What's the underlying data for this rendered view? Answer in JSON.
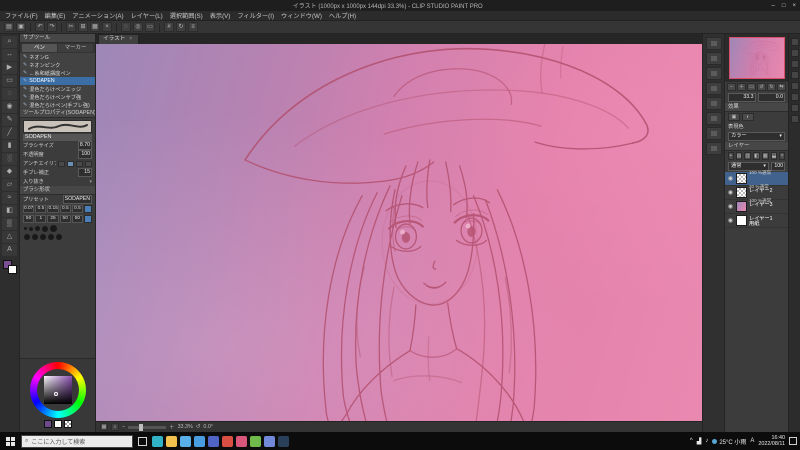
{
  "window": {
    "title": "イラスト (1000px x 1000px 144dpi 33.3%) - CLIP STUDIO PAINT PRO",
    "controls": {
      "minimize": "–",
      "maximize": "□",
      "close": "×"
    }
  },
  "menubar": {
    "items": [
      "ファイル(F)",
      "編集(E)",
      "アニメーション(A)",
      "レイヤー(L)",
      "選択範囲(S)",
      "表示(V)",
      "フィルター(I)",
      "ウィンドウ(W)",
      "ヘルプ(H)"
    ]
  },
  "toolbar": {
    "icons": [
      {
        "name": "new",
        "glyph": "▤"
      },
      {
        "name": "save",
        "glyph": "▣"
      },
      {
        "name": "undo",
        "glyph": "↶"
      },
      {
        "name": "redo",
        "glyph": "↷"
      },
      {
        "name": "cut",
        "glyph": "✂"
      },
      {
        "name": "copy",
        "glyph": "⊞"
      },
      {
        "name": "paste",
        "glyph": "▦"
      },
      {
        "name": "delete",
        "glyph": "×"
      },
      {
        "name": "deselect",
        "glyph": "◌"
      },
      {
        "name": "invert-selection",
        "glyph": "◎"
      },
      {
        "name": "selection-launcher",
        "glyph": "▭"
      },
      {
        "name": "grid",
        "glyph": "#"
      },
      {
        "name": "rotate-view",
        "glyph": "↻"
      },
      {
        "name": "workspace-settings",
        "glyph": "≡"
      }
    ]
  },
  "toolstrip": {
    "tools": [
      {
        "name": "zoom",
        "glyph": "⌕"
      },
      {
        "name": "move",
        "glyph": "↔"
      },
      {
        "name": "operation",
        "glyph": "▶"
      },
      {
        "name": "selection",
        "glyph": "▭"
      },
      {
        "name": "lasso",
        "glyph": "◌"
      },
      {
        "name": "eyedropper",
        "glyph": "◉"
      },
      {
        "name": "pen",
        "glyph": "✎"
      },
      {
        "name": "pencil",
        "glyph": "╱"
      },
      {
        "name": "brush",
        "glyph": "▮"
      },
      {
        "name": "airbrush",
        "glyph": "░"
      },
      {
        "name": "decoration",
        "glyph": "◆"
      },
      {
        "name": "eraser",
        "glyph": "▱"
      },
      {
        "name": "blend",
        "glyph": "≈"
      },
      {
        "name": "fill",
        "glyph": "◧"
      },
      {
        "name": "gradient",
        "glyph": "▒"
      },
      {
        "name": "figure",
        "glyph": "△"
      },
      {
        "name": "text",
        "glyph": "A"
      }
    ],
    "main_color": "#7b4f93",
    "sub_color": "#ffffff"
  },
  "subtool": {
    "panel_title": "サブツール",
    "tabs": [
      "ペン",
      "マーカー"
    ],
    "items": [
      "ネオンG",
      "ネオンピンク",
      "←糸和紙講座ペン",
      "SODAPEN",
      "混色だらけペンエッジ",
      "混色だらけペンサブ強",
      "混色だらけペン(手ブレ強)"
    ]
  },
  "tool_property": {
    "panel_title": "ツールプロパティ(SODAPEN)",
    "brush_name": "SODAPEN",
    "sliders": [
      {
        "label": "ブラシサイズ",
        "value": "8.70"
      },
      {
        "label": "不透明度",
        "value": "100"
      },
      {
        "label": "アンチエイリアス",
        "value": ""
      },
      {
        "label": "手ブレ補正",
        "value": "15"
      }
    ],
    "toggle_label": "入り抜き",
    "shape_label": "ブラシ形状"
  },
  "brush_shape": {
    "preset_label": "プリセット",
    "preset_value": "SODAPEN",
    "row1": [
      "0.07",
      "0.5",
      "0.15",
      "0.5",
      "0.5"
    ],
    "row2": [
      "50",
      "1",
      "25",
      "50",
      "50"
    ]
  },
  "color_wheel": {
    "selected_color": "#6d4b8a"
  },
  "canvas": {
    "tab": "イラスト",
    "close_glyph": "×",
    "zoom_out": "−",
    "zoom_in": "＋",
    "status_zoom": "33.3%",
    "rotate_glyph": "↺",
    "status_angle": "0.0°"
  },
  "navigator": {
    "buttons": [
      "−",
      "＋",
      "▭",
      "↺",
      "↻",
      "⇆"
    ],
    "zoom": "33.3",
    "angle": "0.0"
  },
  "layer_property": {
    "effect_label": "効果",
    "effect_icons": [
      "▣",
      "◐"
    ],
    "expression_label": "表現色",
    "expression_value": "カラー",
    "dropdown_glyph": "▾"
  },
  "layers": {
    "panel_title": "レイヤー",
    "tools": [
      "+",
      "▤",
      "▥",
      "◧",
      "▦",
      "⬓",
      "×"
    ],
    "blend_mode": "通常",
    "dropdown_glyph": "▾",
    "opacity": "100",
    "eye_glyph": "◉",
    "rows": [
      {
        "meta": "100 %通常",
        "name": "レイヤー2",
        "thumb": "checker"
      },
      {
        "meta": "20 %通常",
        "name": "レイヤー3",
        "thumb": "checker"
      },
      {
        "meta": "100 %通常",
        "name": "レイヤー1",
        "thumb": "art"
      },
      {
        "meta": "",
        "name": "用紙",
        "thumb": "paper"
      }
    ]
  },
  "taskbar": {
    "search_placeholder": "ここに入力して検索",
    "search_icon_glyph": "⌕",
    "apps": [
      {
        "name": "edge",
        "color": "#30b3c7"
      },
      {
        "name": "explorer",
        "color": "#f2c14e"
      },
      {
        "name": "store",
        "color": "#59b0e8"
      },
      {
        "name": "mail",
        "color": "#4a9de0"
      },
      {
        "name": "photos",
        "color": "#5064c8"
      },
      {
        "name": "calendar",
        "color": "#d94f43"
      },
      {
        "name": "clip-studio",
        "color": "#d8567a"
      },
      {
        "name": "chrome",
        "color": "#6fba4a"
      },
      {
        "name": "discord",
        "color": "#7289da"
      },
      {
        "name": "steam",
        "color": "#2a3f5a"
      }
    ],
    "tray": {
      "chevron": "^",
      "icons": [
        "▟",
        "♪"
      ],
      "weather": "25°C 小雨",
      "ime": "A",
      "time": "16:40",
      "date": "2022/08/11"
    }
  },
  "artwork": {
    "bg_from": "#9d88b8",
    "bg_mid": "#cf7fae",
    "bg_to": "#ea89b0",
    "line_color": "#b24f6d",
    "subject": "sketch of girl with wide-brim hat"
  }
}
